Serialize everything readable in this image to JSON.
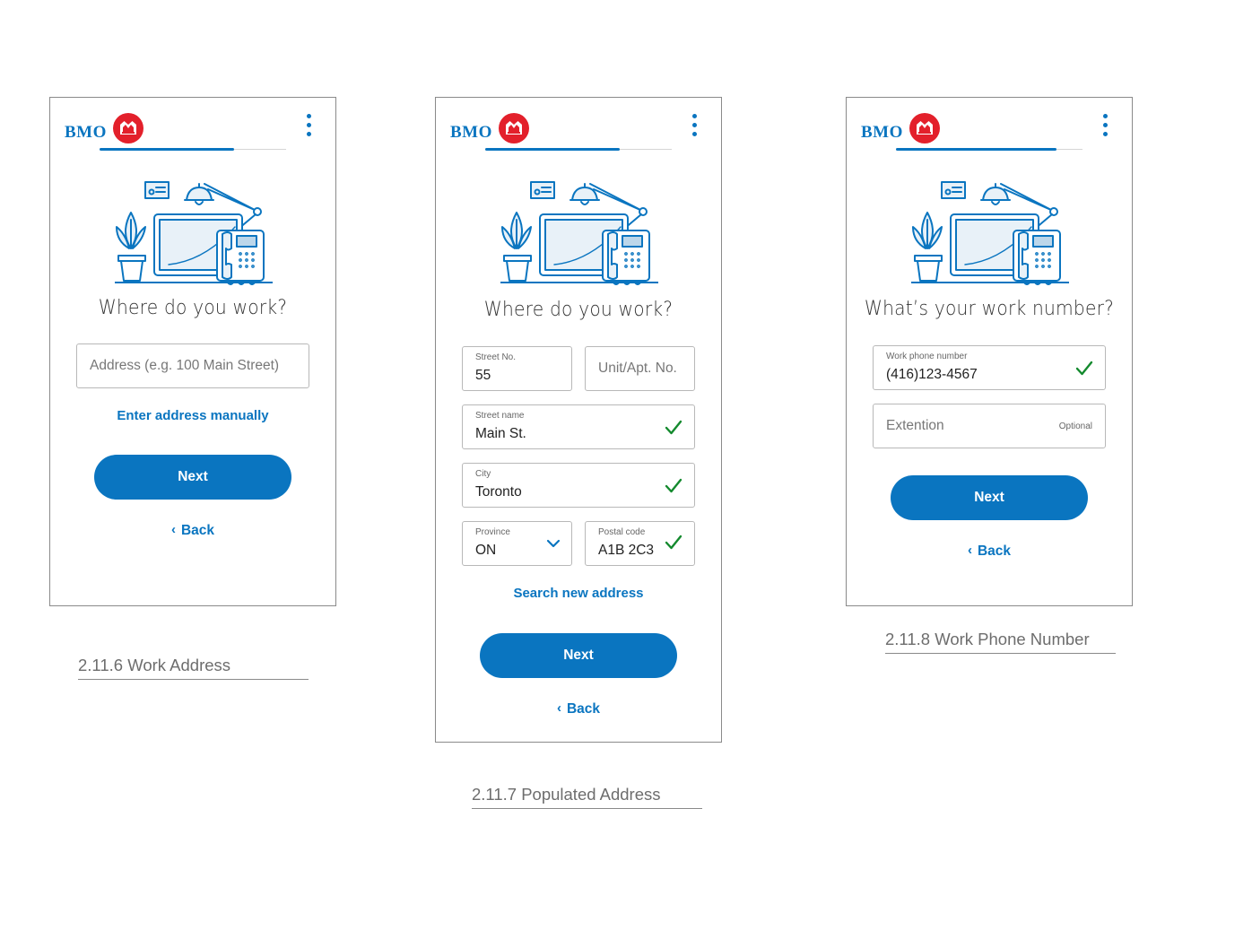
{
  "brand": {
    "name": "BMO",
    "color_primary": "#0a75c0",
    "color_logo": "#e3202b",
    "color_check": "#148a2e"
  },
  "screens": [
    {
      "title": "Where do you work?",
      "progress": 0.72,
      "address_placeholder": "Address (e.g. 100 Main Street)",
      "link": "Enter address manually",
      "next": "Next",
      "back": "Back",
      "caption": "2.11.6 Work Address"
    },
    {
      "title": "Where do you work?",
      "progress": 0.72,
      "street_no": {
        "label": "Street No.",
        "value": "55"
      },
      "unit": {
        "placeholder": "Unit/Apt. No."
      },
      "street_name": {
        "label": "Street name",
        "value": "Main St."
      },
      "city": {
        "label": "City",
        "value": "Toronto"
      },
      "province": {
        "label": "Province",
        "value": "ON"
      },
      "postal": {
        "label": "Postal code",
        "value": "A1B 2C3"
      },
      "link": "Search new address",
      "next": "Next",
      "back": "Back",
      "caption": "2.11.7 Populated Address"
    },
    {
      "title": "What’s your work number?",
      "progress": 0.86,
      "phone": {
        "label": "Work phone number",
        "value": "(416)123-4567"
      },
      "extension": {
        "placeholder": "Extention",
        "optional": "Optional"
      },
      "next": "Next",
      "back": "Back",
      "caption": "2.11.8 Work Phone Number"
    }
  ],
  "icons": [
    "bmo-logo-icon",
    "kebab-menu-icon",
    "checkmark-icon",
    "chevron-down-icon",
    "chevron-left-icon",
    "workspace-illustration"
  ]
}
